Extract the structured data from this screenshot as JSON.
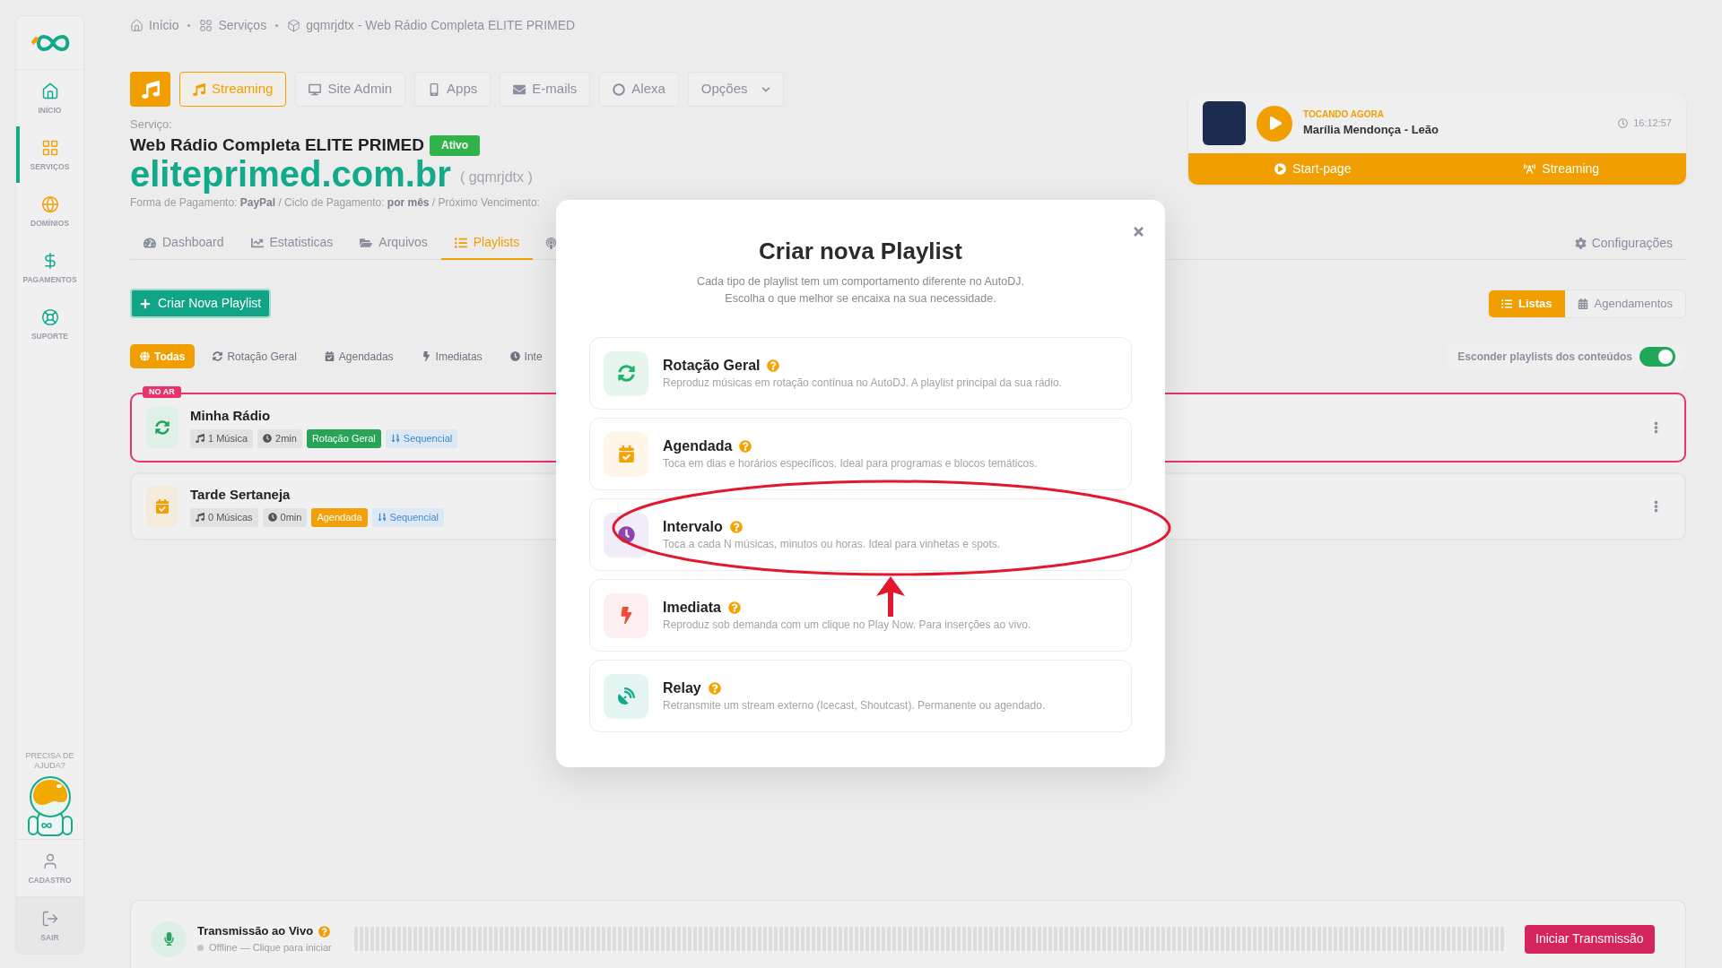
{
  "sidebar": {
    "items": [
      {
        "label": "INÍCIO",
        "selected": false
      },
      {
        "label": "SERVIÇOS",
        "selected": true
      },
      {
        "label": "DOMÍNIOS",
        "selected": false
      },
      {
        "label": "PAGAMENTOS",
        "selected": false
      },
      {
        "label": "SUPORTE",
        "selected": false
      }
    ],
    "help_label": "PRECISA DE AJUDA?",
    "footer_items": [
      {
        "label": "CADASTRO"
      },
      {
        "label": "SAIR"
      }
    ]
  },
  "breadcrumb": [
    "Início",
    "Serviços",
    "gqmrjdtx - Web Rádio Completa ELITE PRIMED"
  ],
  "service_nav": [
    {
      "label": "Streaming",
      "kind": "link",
      "selected": true
    },
    {
      "label": "Site Admin",
      "kind": "link",
      "selected": false
    },
    {
      "label": "Apps",
      "kind": "link",
      "selected": false
    },
    {
      "label": "E-mails",
      "kind": "link",
      "selected": false
    },
    {
      "label": "Alexa",
      "kind": "link",
      "selected": false
    },
    {
      "label": "Opções",
      "kind": "dropdown",
      "selected": false
    }
  ],
  "service": {
    "label": "Serviço:",
    "name": "Web Rádio Completa ELITE PRIMED",
    "status": "Ativo",
    "domain": "eliteprimed.com.br",
    "username": "( gqmrjdtx )",
    "billing": "Forma de Pagamento: **PayPal** / Ciclo de Pagamento: **por mês** / Próximo Vencimento:"
  },
  "now_playing": {
    "label": "TOCANDO AGORA",
    "track": "Marília Mendonça - Leão",
    "time": "16:12:57",
    "links": [
      "Start-page",
      "Streaming"
    ]
  },
  "tabs": [
    {
      "label": "Dashboard",
      "selected": false
    },
    {
      "label": "Estatisticas",
      "selected": false
    },
    {
      "label": "Arquivos",
      "selected": false
    },
    {
      "label": "Playlists",
      "selected": true
    }
  ],
  "settings_link": "Configurações",
  "create_button": "Criar Nova Playlist",
  "view_toggle": [
    {
      "label": "Listas",
      "selected": true
    },
    {
      "label": "Agendamentos",
      "selected": false
    }
  ],
  "filters": [
    {
      "label": "Todas",
      "selected": true
    },
    {
      "label": "Rotação Geral",
      "selected": false
    },
    {
      "label": "Agendadas",
      "selected": false
    },
    {
      "label": "Imediatas",
      "selected": false
    },
    {
      "label": "Inte",
      "selected": false
    }
  ],
  "hide_toggle": {
    "label": "Esconder playlists dos conteúdos",
    "on": true
  },
  "playlists": [
    {
      "kind": "rotation",
      "name": "Minha Rádio",
      "on_air": true,
      "badge": "NO AR",
      "count": "1 Música",
      "duration": "2min",
      "type": "Rotação Geral",
      "order": "Sequencial"
    },
    {
      "kind": "scheduled",
      "name": "Tarde Sertaneja",
      "on_air": false,
      "count": "0 Músicas",
      "duration": "0min",
      "type": "Agendada",
      "order": "Sequencial"
    }
  ],
  "live": {
    "title": "Transmissão ao Vivo",
    "online": false,
    "status": "Offline — Clique para iniciar",
    "button": "Iniciar Transmissão"
  },
  "modal": {
    "title": "Criar nova Playlist",
    "subtitle": [
      "Cada tipo de playlist tem um comportamento diferente no AutoDJ.",
      "Escolha o que melhor se encaixa na sua necessidade."
    ],
    "options": [
      {
        "kind": "rotation",
        "title": "Rotação Geral",
        "description": "Reproduz músicas em rotação contínua no AutoDJ. A playlist principal da sua rádio."
      },
      {
        "kind": "scheduled",
        "title": "Agendada",
        "description": "Toca em dias e horários específicos. Ideal para programas e blocos temáticos."
      },
      {
        "kind": "interval",
        "title": "Intervalo",
        "description": "Toca a cada N músicas, minutos ou horas. Ideal para vinhetas e spots."
      },
      {
        "kind": "immediate",
        "title": "Imediata",
        "description": "Reproduz sob demanda com um clique no Play Now. Para inserções ao vivo."
      },
      {
        "kind": "relay",
        "title": "Relay",
        "description": "Retransmite um stream externo (Icecast, Shoutcast). Permanente ou agendado."
      }
    ]
  }
}
